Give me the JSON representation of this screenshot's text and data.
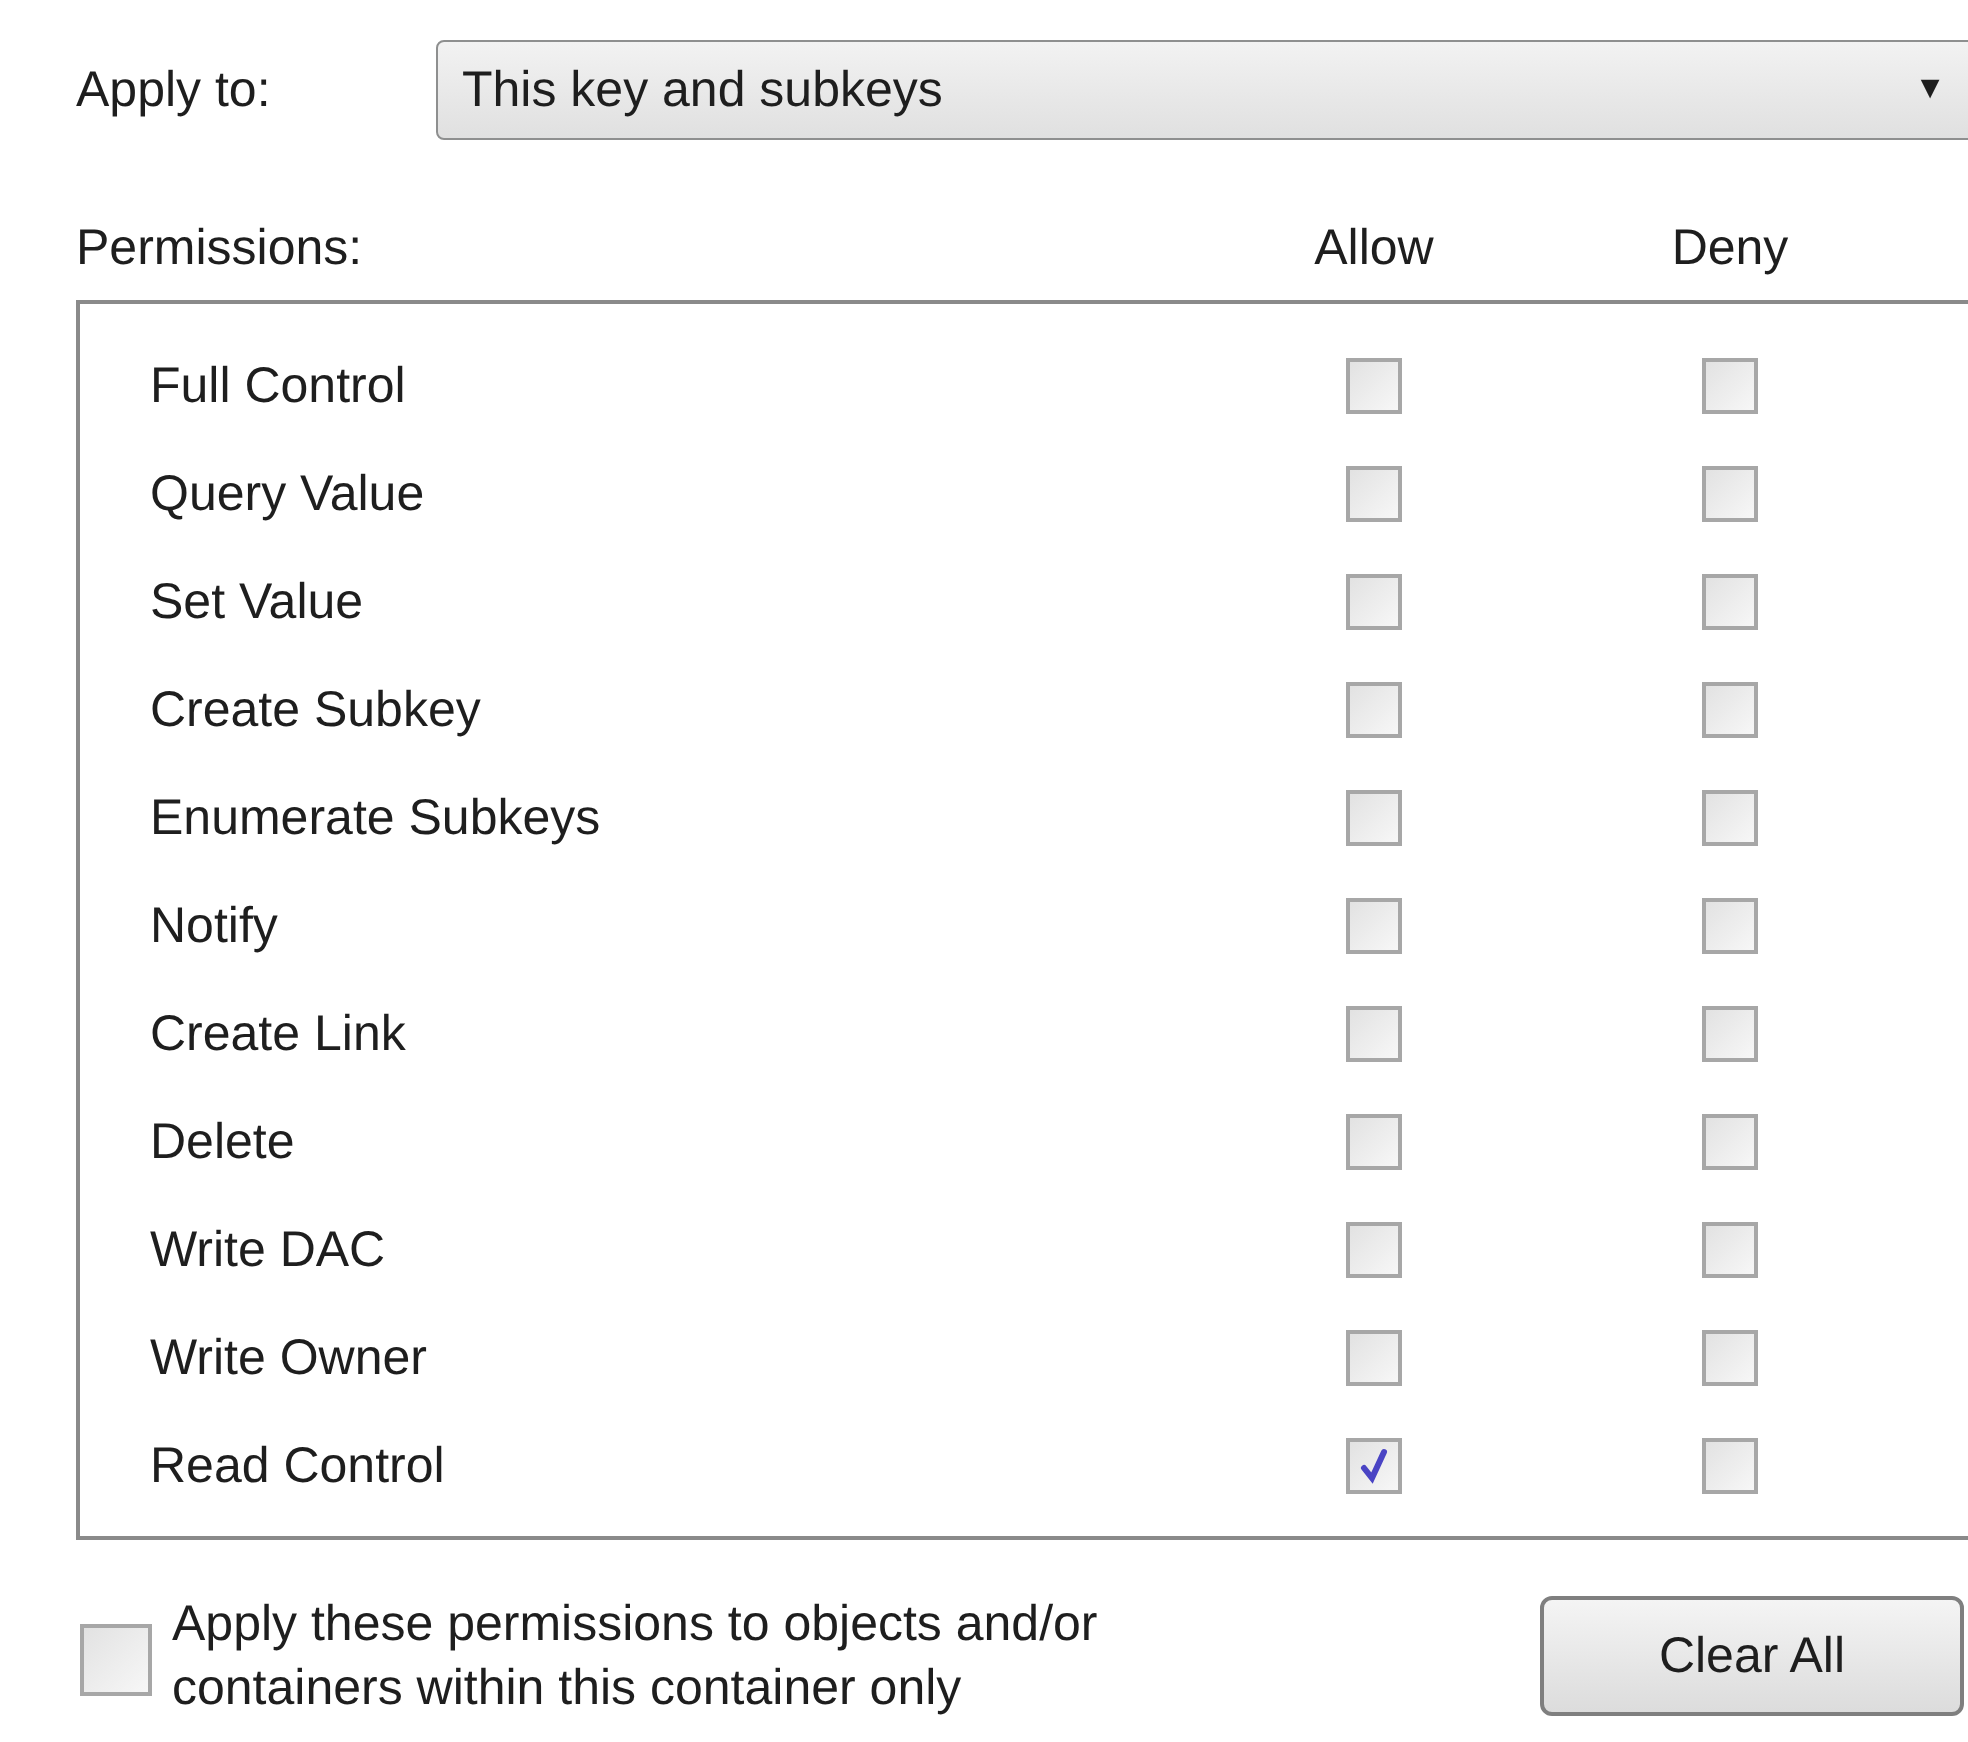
{
  "apply_to": {
    "label": "Apply to:",
    "value": "This key and subkeys",
    "arrow": "▼"
  },
  "permissions": {
    "label": "Permissions:",
    "columns": [
      "Allow",
      "Deny"
    ],
    "rows": [
      {
        "name": "Full Control",
        "allow": false,
        "deny": false
      },
      {
        "name": "Query Value",
        "allow": false,
        "deny": false
      },
      {
        "name": "Set Value",
        "allow": false,
        "deny": false
      },
      {
        "name": "Create Subkey",
        "allow": false,
        "deny": false
      },
      {
        "name": "Enumerate Subkeys",
        "allow": false,
        "deny": false
      },
      {
        "name": "Notify",
        "allow": false,
        "deny": false
      },
      {
        "name": "Create Link",
        "allow": false,
        "deny": false
      },
      {
        "name": "Delete",
        "allow": false,
        "deny": false
      },
      {
        "name": "Write DAC",
        "allow": false,
        "deny": false
      },
      {
        "name": "Write Owner",
        "allow": false,
        "deny": false
      },
      {
        "name": "Read Control",
        "allow": true,
        "deny": false
      }
    ]
  },
  "apply_only": {
    "label": "Apply these permissions to objects and/or containers within this container only",
    "checked": false
  },
  "clear_button": "Clear All"
}
